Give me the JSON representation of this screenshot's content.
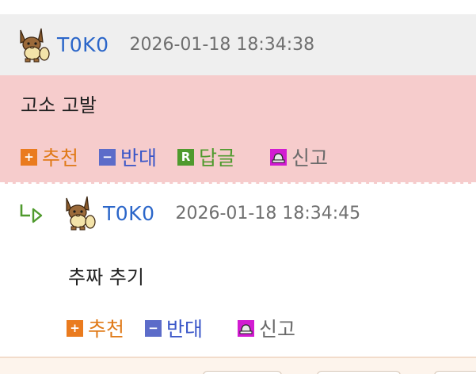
{
  "comment": {
    "author": "T0K0",
    "timestamp": "2026-01-18 18:34:38",
    "text": "고소 고발",
    "actions": {
      "upvote_icon": "+",
      "upvote_label": "추천",
      "downvote_icon": "−",
      "downvote_label": "반대",
      "reply_icon": "R",
      "reply_label": "답글",
      "report_label": "신고"
    }
  },
  "reply": {
    "author": "T0K0",
    "timestamp": "2026-01-18 18:34:45",
    "text": "추짜 추기",
    "actions": {
      "upvote_icon": "+",
      "upvote_label": "추천",
      "downvote_icon": "−",
      "downvote_label": "반대",
      "report_label": "신고"
    }
  },
  "colors": {
    "author": "#2b66c9",
    "highlight_bg": "#f6cccc",
    "upvote": "#ea7b1e",
    "downvote": "#5c6cc9",
    "reply": "#4f9a2d",
    "report": "#d21bd2"
  },
  "icons": {
    "avatar": "eevee-avatar-icon",
    "reply_arrow": "reply-arrow-icon",
    "report": "siren-icon"
  }
}
